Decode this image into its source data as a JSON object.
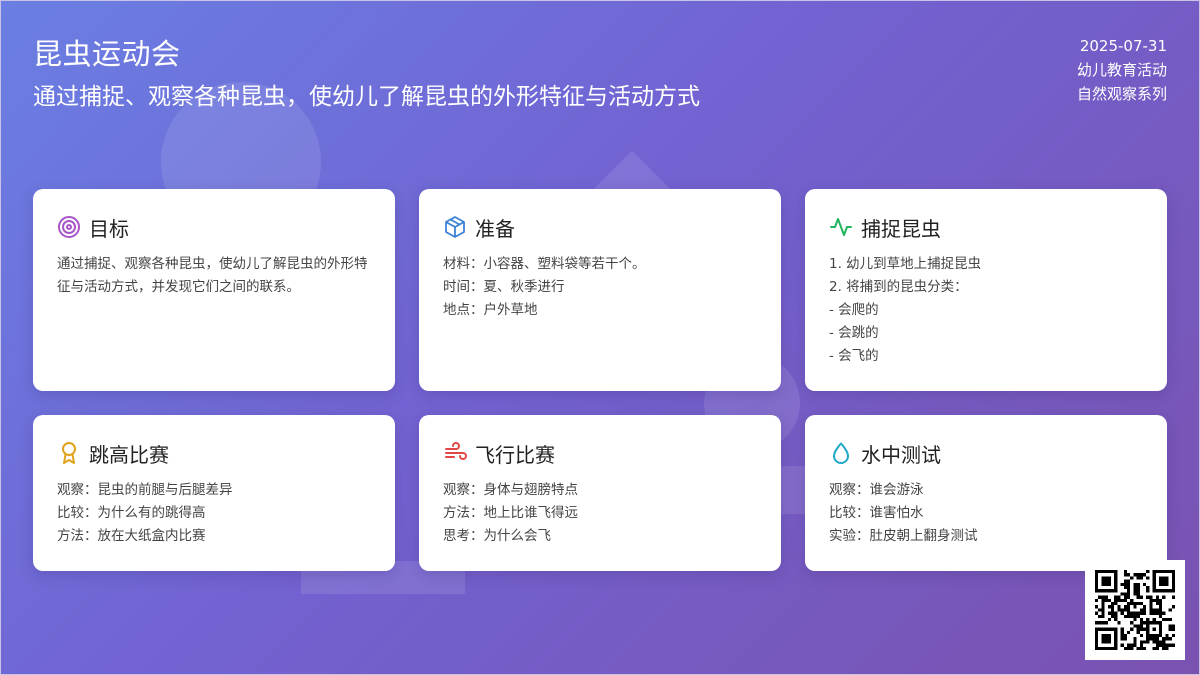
{
  "header": {
    "title": "昆虫运动会",
    "subtitle": "通过捕捉、观察各种昆虫，使幼儿了解昆虫的外形特征与活动方式",
    "date": "2025-07-31",
    "category": "幼儿教育活动",
    "series": "自然观察系列"
  },
  "cards": {
    "goal": {
      "title": "目标",
      "icon": "target-icon",
      "color": "#a855c7",
      "text": "通过捕捉、观察各种昆虫，使幼儿了解昆虫的外形特征与活动方式，并发现它们之间的联系。"
    },
    "prep": {
      "title": "准备",
      "icon": "box-icon",
      "color": "#3b82d6",
      "lines": [
        "材料：小容器、塑料袋等若干个。",
        "时间：夏、秋季进行",
        "地点：户外草地"
      ]
    },
    "catch": {
      "title": "捕捉昆虫",
      "icon": "activity-icon",
      "color": "#22b35e",
      "lines": [
        "1. 幼儿到草地上捕捉昆虫",
        "2. 将捕到的昆虫分类：",
        "- 会爬的",
        "- 会跳的",
        "- 会飞的"
      ]
    },
    "jump": {
      "title": "跳高比赛",
      "icon": "award-icon",
      "color": "#e0a21a",
      "lines": [
        "观察：昆虫的前腿与后腿差异",
        "比较：为什么有的跳得高",
        "方法：放在大纸盒内比赛"
      ]
    },
    "fly": {
      "title": "飞行比赛",
      "icon": "wind-icon",
      "color": "#e04848",
      "lines": [
        "观察：身体与翅膀特点",
        "方法：地上比谁飞得远",
        "思考：为什么会飞"
      ]
    },
    "water": {
      "title": "水中测试",
      "icon": "droplet-icon",
      "color": "#1fa8c9",
      "lines": [
        "观察：谁会游泳",
        "比较：谁害怕水",
        "实验：肚皮朝上翻身测试"
      ]
    }
  },
  "qr": {
    "icon": "qr-code-icon"
  }
}
